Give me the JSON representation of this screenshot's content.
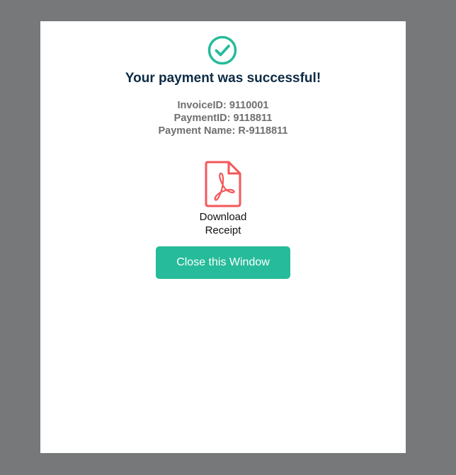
{
  "title": "Your payment was successful!",
  "details": {
    "invoice": "InvoiceID: 9110001",
    "payment": "PaymentID: 9118811",
    "name": "Payment Name: R-9118811"
  },
  "download": {
    "line1": "Download",
    "line2": "Receipt"
  },
  "close_label": "Close this Window",
  "colors": {
    "accent": "#26bb9a",
    "title": "#0d2b45",
    "pdf": "#f4575a"
  }
}
